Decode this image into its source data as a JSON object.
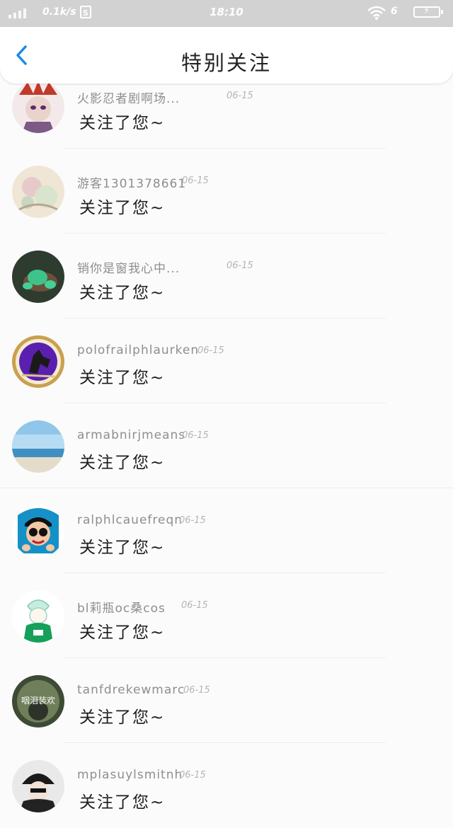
{
  "status_bar": {
    "net_speed": "0.1k/s",
    "sd_label": "S",
    "time": "18:10",
    "battery_percent": "6"
  },
  "header": {
    "title": "特别关注"
  },
  "items": [
    {
      "name": "火影忍者剧啊场...",
      "date": "06-15",
      "message": "关注了您~"
    },
    {
      "name": "游客1301378661",
      "date": "06-15",
      "message": "关注了您~"
    },
    {
      "name": "销你是窗我心中...",
      "date": "06-15",
      "message": "关注了您~"
    },
    {
      "name": "polofrailphlaurken",
      "date": "06-15",
      "message": "关注了您~"
    },
    {
      "name": "armabnirjmeans",
      "date": "06-15",
      "message": "关注了您~"
    },
    {
      "name": "ralphlcauefreqn",
      "date": "06-15",
      "message": "关注了您~"
    },
    {
      "name": "bl莉瓶oc桑cos",
      "date": "06-15",
      "message": "关注了您~"
    },
    {
      "name": "tanfdrekewmarc",
      "date": "06-15",
      "message": "关注了您~"
    },
    {
      "name": "mplasuylsmitnh",
      "date": "06-15",
      "message": "关注了您~"
    }
  ],
  "avatar_badges": {
    "item_8": "咽泪装欢"
  },
  "colors": {
    "accent": "#1e88e5",
    "status_bar": "#d2d2d2"
  }
}
